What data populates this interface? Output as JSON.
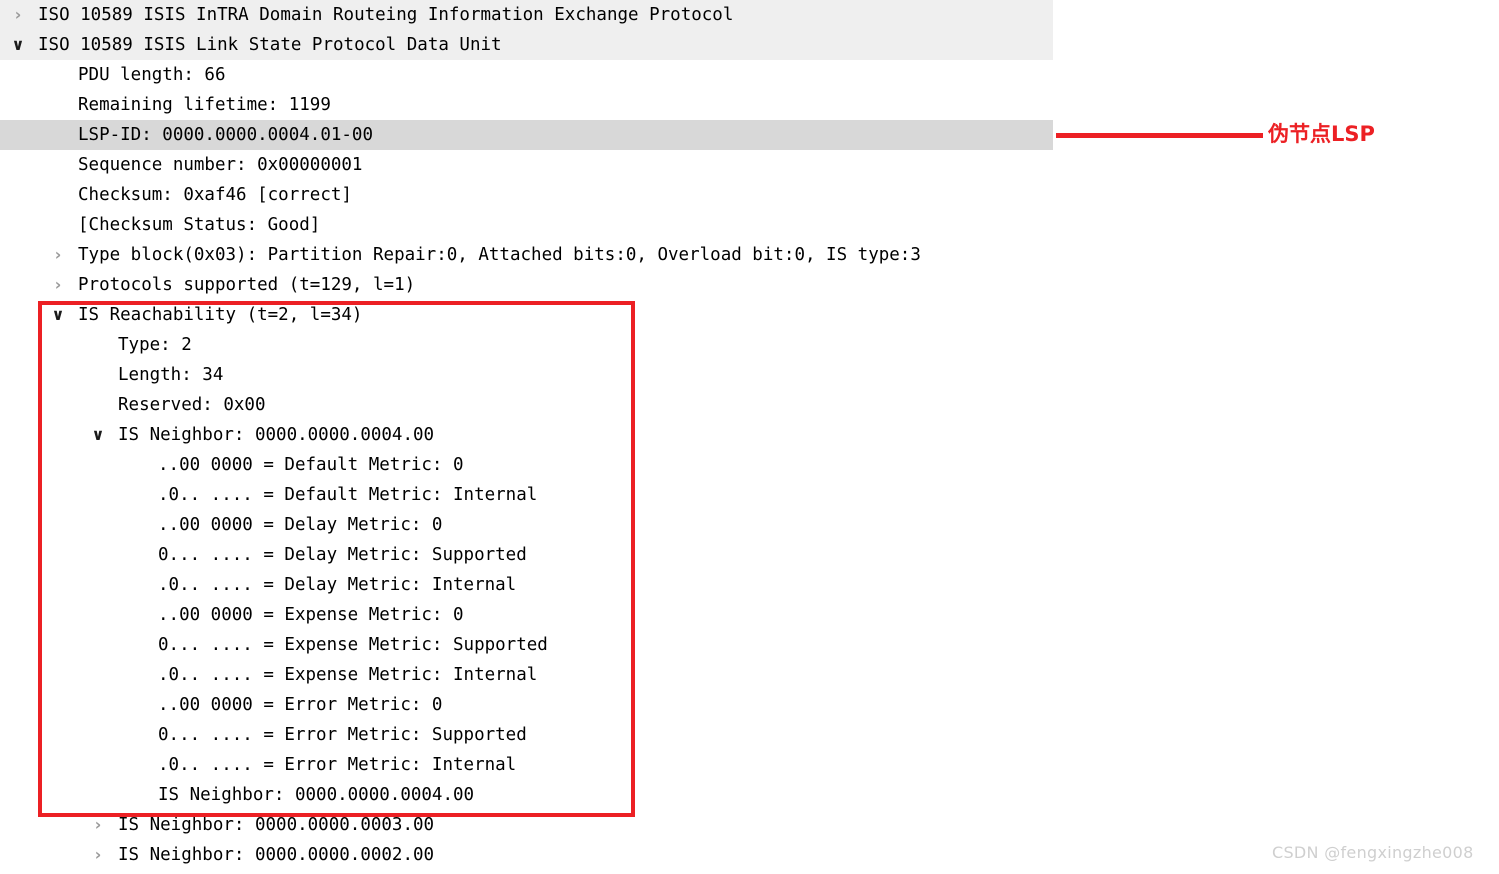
{
  "colors": {
    "annotation_red": "#ec2024",
    "header_band": "#efefef",
    "selected_row": "#d8d8d8",
    "text": "#000000",
    "twisty_collapsed": "#9a9a9a",
    "watermark": "#cfcfcf"
  },
  "packet_detail": {
    "rows": [
      {
        "label": "ISO 10589 ISIS InTRA Domain Routeing Information Exchange Protocol",
        "indent": 0,
        "twisty": "collapsed",
        "twisty_glyph": "›",
        "background": "band-light"
      },
      {
        "label": "ISO 10589 ISIS Link State Protocol Data Unit",
        "indent": 0,
        "twisty": "expanded",
        "twisty_glyph": "∨",
        "background": "band-light"
      },
      {
        "label": "PDU length: 66",
        "indent": 1,
        "twisty": "none",
        "twisty_glyph": "",
        "background": "none"
      },
      {
        "label": "Remaining lifetime: 1199",
        "indent": 1,
        "twisty": "none",
        "twisty_glyph": "",
        "background": "none"
      },
      {
        "label": "LSP-ID: 0000.0000.0004.01-00",
        "indent": 1,
        "twisty": "none",
        "twisty_glyph": "",
        "background": "band-sel"
      },
      {
        "label": "Sequence number: 0x00000001",
        "indent": 1,
        "twisty": "none",
        "twisty_glyph": "",
        "background": "none"
      },
      {
        "label": "Checksum: 0xaf46 [correct]",
        "indent": 1,
        "twisty": "none",
        "twisty_glyph": "",
        "background": "none"
      },
      {
        "label": "[Checksum Status: Good]",
        "indent": 1,
        "twisty": "none",
        "twisty_glyph": "",
        "background": "none"
      },
      {
        "label": "Type block(0x03): Partition Repair:0, Attached bits:0, Overload bit:0, IS type:3",
        "indent": 1,
        "twisty": "collapsed",
        "twisty_glyph": "›",
        "background": "none"
      },
      {
        "label": "Protocols supported (t=129, l=1)",
        "indent": 1,
        "twisty": "collapsed",
        "twisty_glyph": "›",
        "background": "none"
      },
      {
        "label": "IS Reachability (t=2, l=34)",
        "indent": 1,
        "twisty": "expanded",
        "twisty_glyph": "∨",
        "background": "none"
      },
      {
        "label": "Type: 2",
        "indent": 2,
        "twisty": "none",
        "twisty_glyph": "",
        "background": "none"
      },
      {
        "label": "Length: 34",
        "indent": 2,
        "twisty": "none",
        "twisty_glyph": "",
        "background": "none"
      },
      {
        "label": "Reserved: 0x00",
        "indent": 2,
        "twisty": "none",
        "twisty_glyph": "",
        "background": "none"
      },
      {
        "label": "IS Neighbor: 0000.0000.0004.00",
        "indent": 2,
        "twisty": "expanded",
        "twisty_glyph": "∨",
        "background": "none"
      },
      {
        "label": "..00 0000 = Default Metric: 0",
        "indent": 3,
        "twisty": "none",
        "twisty_glyph": "",
        "background": "none"
      },
      {
        "label": ".0.. .... = Default Metric: Internal",
        "indent": 3,
        "twisty": "none",
        "twisty_glyph": "",
        "background": "none"
      },
      {
        "label": "..00 0000 = Delay Metric: 0",
        "indent": 3,
        "twisty": "none",
        "twisty_glyph": "",
        "background": "none"
      },
      {
        "label": "0... .... = Delay Metric: Supported",
        "indent": 3,
        "twisty": "none",
        "twisty_glyph": "",
        "background": "none"
      },
      {
        "label": ".0.. .... = Delay Metric: Internal",
        "indent": 3,
        "twisty": "none",
        "twisty_glyph": "",
        "background": "none"
      },
      {
        "label": "..00 0000 = Expense Metric: 0",
        "indent": 3,
        "twisty": "none",
        "twisty_glyph": "",
        "background": "none"
      },
      {
        "label": "0... .... = Expense Metric: Supported",
        "indent": 3,
        "twisty": "none",
        "twisty_glyph": "",
        "background": "none"
      },
      {
        "label": ".0.. .... = Expense Metric: Internal",
        "indent": 3,
        "twisty": "none",
        "twisty_glyph": "",
        "background": "none"
      },
      {
        "label": "..00 0000 = Error Metric: 0",
        "indent": 3,
        "twisty": "none",
        "twisty_glyph": "",
        "background": "none"
      },
      {
        "label": "0... .... = Error Metric: Supported",
        "indent": 3,
        "twisty": "none",
        "twisty_glyph": "",
        "background": "none"
      },
      {
        "label": ".0.. .... = Error Metric: Internal",
        "indent": 3,
        "twisty": "none",
        "twisty_glyph": "",
        "background": "none"
      },
      {
        "label": "IS Neighbor: 0000.0000.0004.00",
        "indent": 3,
        "twisty": "none",
        "twisty_glyph": "",
        "background": "none"
      },
      {
        "label": "IS Neighbor: 0000.0000.0003.00",
        "indent": 2,
        "twisty": "collapsed",
        "twisty_glyph": "›",
        "background": "none"
      },
      {
        "label": "IS Neighbor: 0000.0000.0002.00",
        "indent": 2,
        "twisty": "collapsed",
        "twisty_glyph": "›",
        "background": "none"
      }
    ]
  },
  "annotations": {
    "pseudonode_callout": {
      "text": "伪节点LSP",
      "target_row_index": 4
    },
    "highlight_box": {
      "description": "IS Reachability TLV block",
      "first_row_index": 10,
      "last_row_index": 26
    }
  },
  "watermark": {
    "text": "CSDN @fengxingzhe008"
  }
}
